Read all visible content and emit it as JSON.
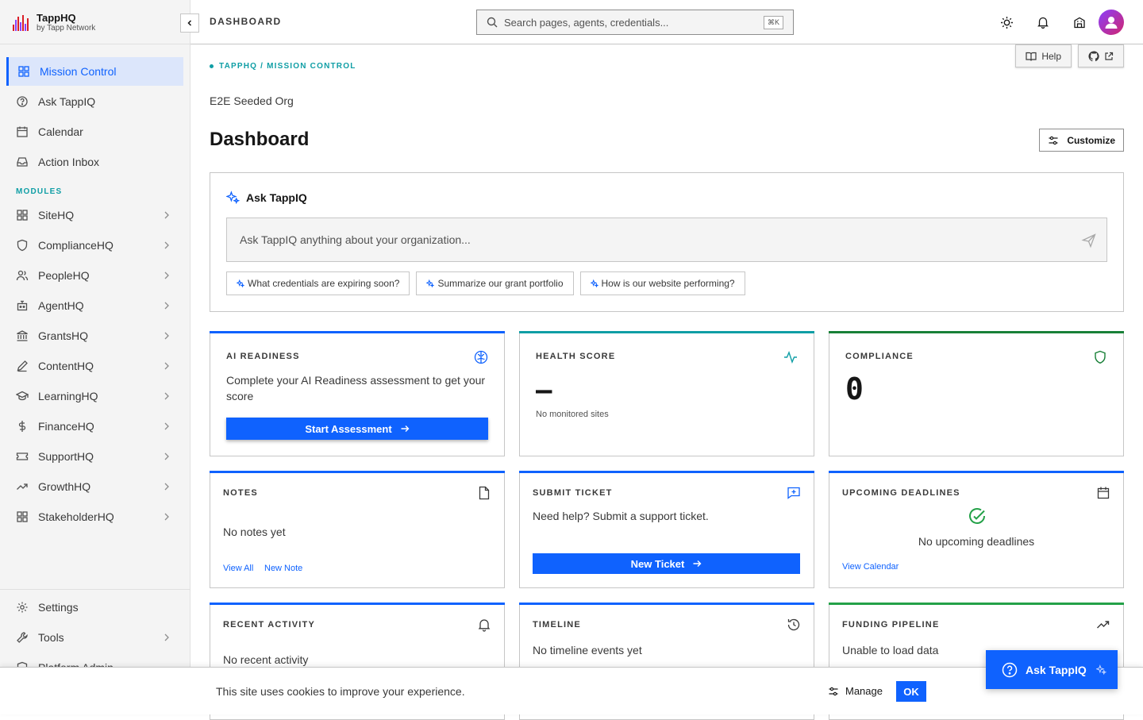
{
  "brand": {
    "name": "TappHQ",
    "sub": "by Tapp Network"
  },
  "sidebar": {
    "primary": [
      {
        "label": "Mission Control",
        "icon": "grid-icon",
        "active": true
      },
      {
        "label": "Ask TappIQ",
        "icon": "help-circle-icon"
      },
      {
        "label": "Calendar",
        "icon": "calendar-icon"
      },
      {
        "label": "Action Inbox",
        "icon": "inbox-icon"
      }
    ],
    "modules_label": "MODULES",
    "modules": [
      {
        "label": "SiteHQ",
        "icon": "grid-icon"
      },
      {
        "label": "ComplianceHQ",
        "icon": "shield-icon"
      },
      {
        "label": "PeopleHQ",
        "icon": "people-icon"
      },
      {
        "label": "AgentHQ",
        "icon": "robot-icon"
      },
      {
        "label": "GrantsHQ",
        "icon": "bank-icon"
      },
      {
        "label": "ContentHQ",
        "icon": "pencil-icon"
      },
      {
        "label": "LearningHQ",
        "icon": "graduation-cap-icon"
      },
      {
        "label": "FinanceHQ",
        "icon": "dollar-icon"
      },
      {
        "label": "SupportHQ",
        "icon": "ticket-icon"
      },
      {
        "label": "GrowthHQ",
        "icon": "trend-up-icon"
      },
      {
        "label": "StakeholderHQ",
        "icon": "grid-icon"
      }
    ],
    "bottom": [
      {
        "label": "Settings",
        "icon": "gear-icon"
      },
      {
        "label": "Tools",
        "icon": "wrench-icon"
      },
      {
        "label": "Platform Admin",
        "icon": "shield-icon"
      }
    ]
  },
  "header": {
    "title": "DASHBOARD",
    "search_placeholder": "Search pages, agents, credentials...",
    "search_shortcut": "⌘K"
  },
  "main": {
    "help_label": "Help",
    "breadcrumb": "TAPPHQ / MISSION CONTROL",
    "org_name": "E2E Seeded Org",
    "page_title": "Dashboard",
    "customize_label": "Customize"
  },
  "ask": {
    "title": "Ask TappIQ",
    "placeholder": "Ask TappIQ anything about your organization...",
    "suggestions": [
      "What credentials are expiring soon?",
      "Summarize our grant portfolio",
      "How is our website performing?"
    ]
  },
  "cards": {
    "ai": {
      "title": "AI READINESS",
      "text": "Complete your AI Readiness assessment to get your score",
      "button": "Start Assessment",
      "color": "#0f62fe"
    },
    "health": {
      "title": "HEALTH SCORE",
      "value": "—",
      "sub": "No monitored sites",
      "color": "#0f9ea5"
    },
    "compliance": {
      "title": "COMPLIANCE",
      "value": "0",
      "color": "#198038"
    },
    "notes": {
      "title": "NOTES",
      "text": "No notes yet",
      "link1": "View All",
      "link2": "New Note",
      "color": "#0f62fe"
    },
    "ticket": {
      "title": "SUBMIT TICKET",
      "text": "Need help? Submit a support ticket.",
      "button": "New Ticket",
      "color": "#0f62fe"
    },
    "deadlines": {
      "title": "UPCOMING DEADLINES",
      "text": "No upcoming deadlines",
      "link": "View Calendar",
      "color": "#0f62fe"
    },
    "activity": {
      "title": "RECENT ACTIVITY",
      "text": "No recent activity",
      "color": "#0f62fe"
    },
    "timeline": {
      "title": "TIMELINE",
      "text": "No timeline events yet",
      "color": "#0f62fe"
    },
    "funding": {
      "title": "FUNDING PIPELINE",
      "text": "Unable to load data",
      "color": "#24a148"
    }
  },
  "cookie": {
    "message": "This site uses cookies to improve your experience.",
    "manage": "Manage",
    "ok": "OK"
  },
  "fab": {
    "label": "Ask TappIQ"
  }
}
